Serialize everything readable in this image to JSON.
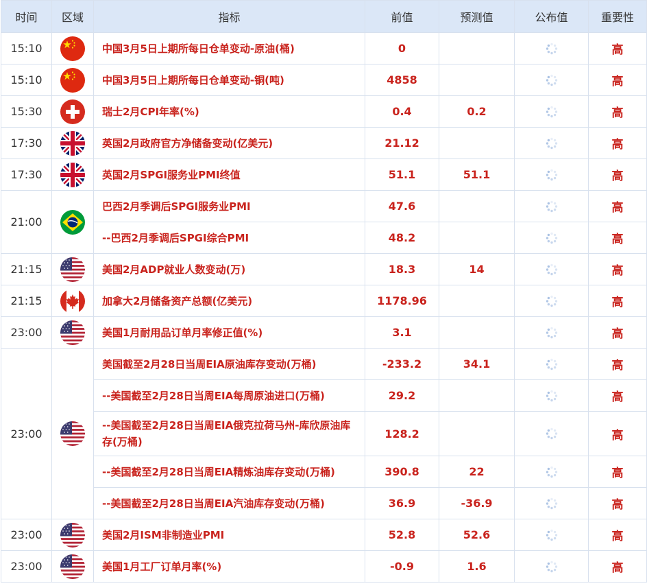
{
  "headers": [
    "时间",
    "区域",
    "指标",
    "前值",
    "预测值",
    "公布值",
    "重要性"
  ],
  "icons": {
    "cn": "china-flag-icon",
    "ch": "switzerland-flag-icon",
    "uk": "uk-flag-icon",
    "br": "brazil-flag-icon",
    "us": "usa-flag-icon",
    "ca": "canada-flag-icon",
    "pending": "loading-spinner-icon"
  },
  "groups": [
    {
      "time": "15:10",
      "flag": "cn",
      "rows": [
        {
          "indicator": "中国3月5日上期所每日仓单变动-原油(桶)",
          "prev": "0",
          "forecast": "",
          "actual": "",
          "importance": "高"
        }
      ]
    },
    {
      "time": "15:10",
      "flag": "cn",
      "rows": [
        {
          "indicator": "中国3月5日上期所每日仓单变动-铜(吨)",
          "prev": "4858",
          "forecast": "",
          "actual": "",
          "importance": "高"
        }
      ]
    },
    {
      "time": "15:30",
      "flag": "ch",
      "rows": [
        {
          "indicator": "瑞士2月CPI年率(%)",
          "prev": "0.4",
          "forecast": "0.2",
          "actual": "",
          "importance": "高"
        }
      ]
    },
    {
      "time": "17:30",
      "flag": "uk",
      "rows": [
        {
          "indicator": "英国2月政府官方净储备变动(亿美元)",
          "prev": "21.12",
          "forecast": "",
          "actual": "",
          "importance": "高"
        }
      ]
    },
    {
      "time": "17:30",
      "flag": "uk",
      "rows": [
        {
          "indicator": "英国2月SPGI服务业PMI终值",
          "prev": "51.1",
          "forecast": "51.1",
          "actual": "",
          "importance": "高"
        }
      ]
    },
    {
      "time": "21:00",
      "flag": "br",
      "rows": [
        {
          "indicator": "巴西2月季调后SPGI服务业PMI",
          "prev": "47.6",
          "forecast": "",
          "actual": "",
          "importance": "高"
        },
        {
          "indicator": "--巴西2月季调后SPGI综合PMI",
          "prev": "48.2",
          "forecast": "",
          "actual": "",
          "importance": "高"
        }
      ]
    },
    {
      "time": "21:15",
      "flag": "us",
      "rows": [
        {
          "indicator": "美国2月ADP就业人数变动(万)",
          "prev": "18.3",
          "forecast": "14",
          "actual": "",
          "importance": "高"
        }
      ]
    },
    {
      "time": "21:15",
      "flag": "ca",
      "rows": [
        {
          "indicator": "加拿大2月储备资产总额(亿美元)",
          "prev": "1178.96",
          "forecast": "",
          "actual": "",
          "importance": "高"
        }
      ]
    },
    {
      "time": "23:00",
      "flag": "us",
      "rows": [
        {
          "indicator": "美国1月耐用品订单月率修正值(%)",
          "prev": "3.1",
          "forecast": "",
          "actual": "",
          "importance": "高"
        }
      ]
    },
    {
      "time": "23:00",
      "flag": "us",
      "rows": [
        {
          "indicator": "美国截至2月28日当周EIA原油库存变动(万桶)",
          "prev": "-233.2",
          "forecast": "34.1",
          "actual": "",
          "importance": "高"
        },
        {
          "indicator": "--美国截至2月28日当周EIA每周原油进口(万桶)",
          "prev": "29.2",
          "forecast": "",
          "actual": "",
          "importance": "高"
        },
        {
          "indicator": "--美国截至2月28日当周EIA俄克拉荷马州-库欣原油库存(万桶)",
          "prev": "128.2",
          "forecast": "",
          "actual": "",
          "importance": "高",
          "tall": true
        },
        {
          "indicator": "--美国截至2月28日当周EIA精炼油库存变动(万桶)",
          "prev": "390.8",
          "forecast": "22",
          "actual": "",
          "importance": "高"
        },
        {
          "indicator": "--美国截至2月28日当周EIA汽油库存变动(万桶)",
          "prev": "36.9",
          "forecast": "-36.9",
          "actual": "",
          "importance": "高"
        }
      ]
    },
    {
      "time": "23:00",
      "flag": "us",
      "rows": [
        {
          "indicator": "美国2月ISM非制造业PMI",
          "prev": "52.8",
          "forecast": "52.6",
          "actual": "",
          "importance": "高"
        }
      ]
    },
    {
      "time": "23:00",
      "flag": "us",
      "rows": [
        {
          "indicator": "美国1月工厂订单月率(%)",
          "prev": "-0.9",
          "forecast": "1.6",
          "actual": "",
          "importance": "高"
        }
      ]
    }
  ]
}
